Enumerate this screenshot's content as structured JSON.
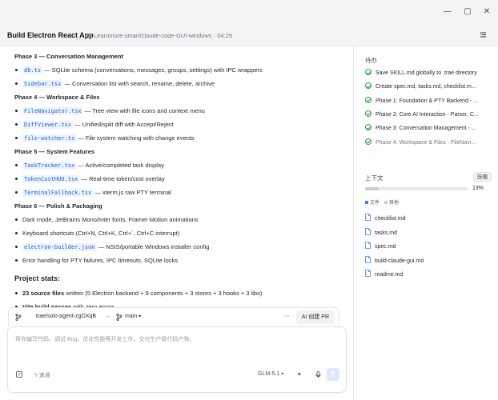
{
  "window": {
    "minimize": "—",
    "maximize": "▢",
    "close": "✕"
  },
  "header": {
    "title": "Build Electron React App",
    "breadcrumb": "Learnmore-smart/claude-code-GUI-windows · 04:29"
  },
  "content": {
    "sections": [
      {
        "title": "Phase 3 — Conversation Management",
        "items": [
          {
            "code": "db.ts",
            "text": " — SQLite schema (conversations, messages, groups, settings) with IPC wrappers"
          },
          {
            "code": "Sidebar.tsx",
            "text": " — Conversation list with search, rename, delete, archive"
          }
        ]
      },
      {
        "title": "Phase 4 — Workspace & Files",
        "items": [
          {
            "code": "FileNavigator.tsx",
            "text": " — Tree view with file icons and context menu"
          },
          {
            "code": "DiffViewer.tsx",
            "text": " — Unified/split diff with Accept/Reject"
          },
          {
            "code": "file-watcher.ts",
            "text": " — File system watching with change events"
          }
        ]
      },
      {
        "title": "Phase 5 — System Features",
        "items": [
          {
            "code": "TaskTracker.tsx",
            "text": " — Active/completed task display"
          },
          {
            "code": "TokenCostHUD.tsx",
            "text": " — Real-time token/cost overlay"
          },
          {
            "code": "TerminalFallback.tsx",
            "text": " — xterm.js raw PTY terminal"
          }
        ]
      },
      {
        "title": "Phase 6 — Polish & Packaging",
        "items": [
          {
            "code": "",
            "text": "Dark mode, JetBrains Mono/Inter fonts, Framer Motion animations"
          },
          {
            "code": "",
            "text": "Keyboard shortcuts (Ctrl+N, Ctrl+K, Ctrl+`, Ctrl+C interrupt)"
          },
          {
            "code": "electron-builder.json",
            "text": " — NSIS/portable Windows installer config"
          },
          {
            "code": "",
            "text": "Error handling for PTY failures, IPC timeouts, SQLite locks"
          }
        ]
      }
    ],
    "stats_title": "Project stats:",
    "stats": [
      {
        "bold": "23 source files",
        "text": " written (5 Electron backend + 9 components + 3 stores + 3 hooks + 3 libs)"
      },
      {
        "bold": "Vite build passes",
        "text": " with zero errors"
      }
    ]
  },
  "branchbar": {
    "branch": "trae/solo-agent-zgOXqB",
    "arrow": "→",
    "base": "main",
    "more": "···",
    "pr_button": "AI 创建 PR"
  },
  "composer": {
    "placeholder": "帮你编写代码、调试 Bug、优化性能等开发工作，交付生产级代码产物。",
    "speed_label": "速通",
    "model": "GLM-5.1"
  },
  "sidebar": {
    "todo_title": "待办",
    "tasks": [
      {
        "label": "Save SKILL.md globally to .trae directory",
        "dim": false
      },
      {
        "label": "Create spec.md, tasks.md, checklist.m...",
        "dim": false
      },
      {
        "label": "Phase 1: Foundation & PTY Backend - ...",
        "dim": false
      },
      {
        "label": "Phase 2: Core AI Interaction - Parser, C...",
        "dim": false
      },
      {
        "label": "Phase 3: Conversation Management - ...",
        "dim": false
      },
      {
        "label": "Phase 4: Workspace & Files - FileNavi...",
        "dim": true
      }
    ],
    "context_title": "上下文",
    "compress_label": "压缩",
    "context_percent": 13,
    "context_percent_label": "13%",
    "legend": [
      {
        "label": "文件",
        "color": "#3b82f6"
      },
      {
        "label": "其他",
        "color": "#c9ccd1"
      }
    ],
    "files": [
      "checklist.md",
      "tasks.md",
      "spec.md",
      "build-claude-gui.md",
      "readme.md"
    ]
  },
  "colors": {
    "accent": "#1a62d6",
    "check": "#2ea043",
    "file_icon": "#3b82f6"
  }
}
